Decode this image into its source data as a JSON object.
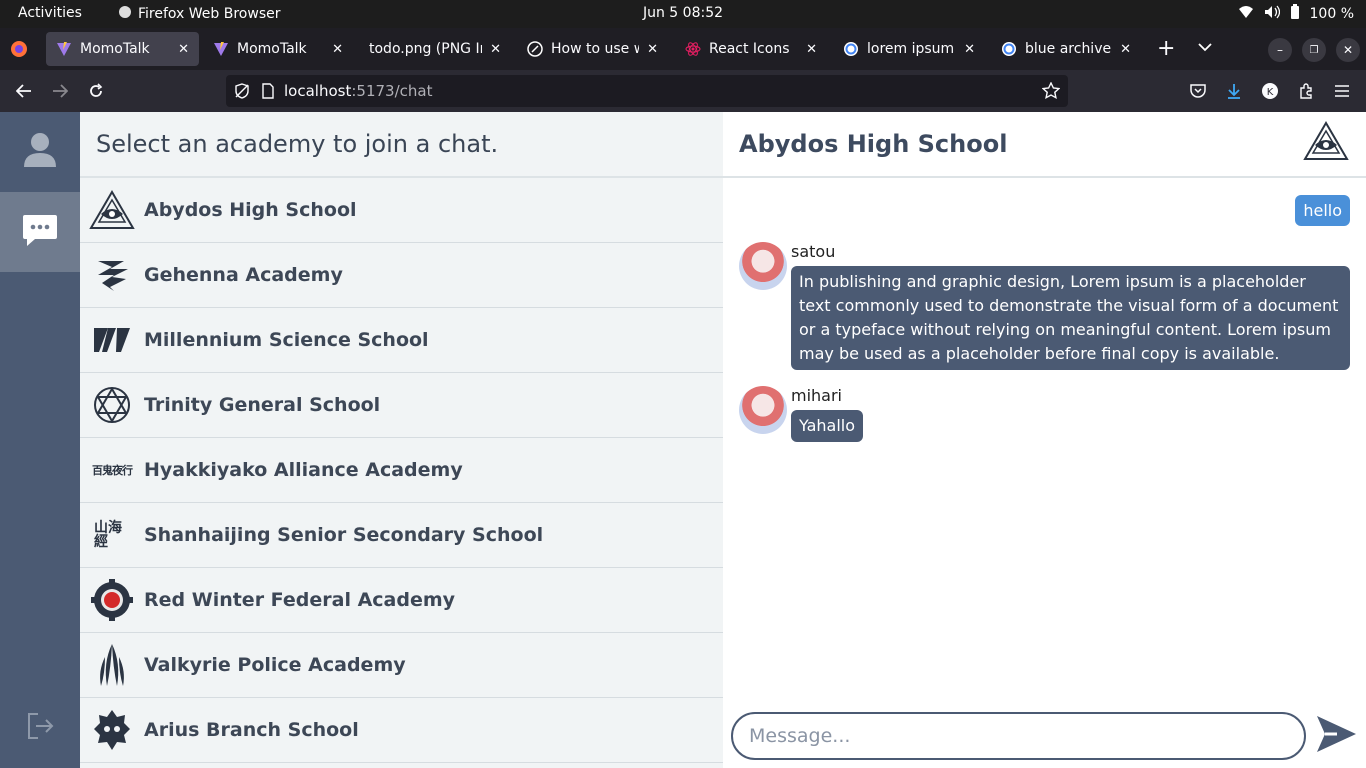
{
  "os": {
    "activities": "Activities",
    "app_name": "Firefox Web Browser",
    "clock": "Jun 5  08:52",
    "battery": "100 %"
  },
  "browser": {
    "tabs": [
      {
        "label": "MomoTalk",
        "icon": "vite-icon",
        "active": true
      },
      {
        "label": "MomoTalk",
        "icon": "vite-icon",
        "active": false
      },
      {
        "label": "todo.png (PNG Ima",
        "icon": "",
        "active": false
      },
      {
        "label": "How to use wit",
        "icon": "compass-icon",
        "active": false
      },
      {
        "label": "React Icons",
        "icon": "react-icon",
        "active": false
      },
      {
        "label": "lorem ipsum - G",
        "icon": "google-icon",
        "active": false
      },
      {
        "label": "blue archive m",
        "icon": "google-icon",
        "active": false
      }
    ],
    "new_tab": "+",
    "url_host": "localhost",
    "url_path": ":5173/chat"
  },
  "sidebar": {
    "items": [
      {
        "name": "profile",
        "icon": "user-icon"
      },
      {
        "name": "chat",
        "icon": "chat-icon",
        "active": true
      }
    ],
    "logout_icon": "logout-icon"
  },
  "list": {
    "heading": "Select an academy to join a chat.",
    "schools": [
      {
        "name": "Abydos High School",
        "icon": "abydos-logo"
      },
      {
        "name": "Gehenna Academy",
        "icon": "gehenna-logo"
      },
      {
        "name": "Millennium Science School",
        "icon": "millennium-logo"
      },
      {
        "name": "Trinity General School",
        "icon": "trinity-logo"
      },
      {
        "name": "Hyakkiyako Alliance Academy",
        "icon": "hyakkiyako-logo",
        "logo_text": "百鬼夜行"
      },
      {
        "name": "Shanhaijing Senior Secondary School",
        "icon": "shanhaijing-logo",
        "logo_text": "山海經"
      },
      {
        "name": "Red Winter Federal Academy",
        "icon": "redwinter-logo"
      },
      {
        "name": "Valkyrie Police Academy",
        "icon": "valkyrie-logo"
      },
      {
        "name": "Arius Branch School",
        "icon": "arius-logo"
      }
    ]
  },
  "chat": {
    "title": "Abydos High School",
    "my_message": "hello",
    "messages": [
      {
        "user": "satou",
        "text": "In publishing and graphic design, Lorem ipsum is a placeholder text commonly used to demonstrate the visual form of a document or a typeface without relying on meaningful content. Lorem ipsum may be used as a placeholder before final copy is available."
      },
      {
        "user": "mihari",
        "text": "Yahallo"
      }
    ],
    "input_placeholder": "Message..."
  },
  "colors": {
    "rail": "#4b5a73",
    "rail_active": "#6f7b8e",
    "list_bg": "#f1f4f5",
    "my_bubble": "#4a90d9",
    "other_bubble": "#4b5a73"
  }
}
